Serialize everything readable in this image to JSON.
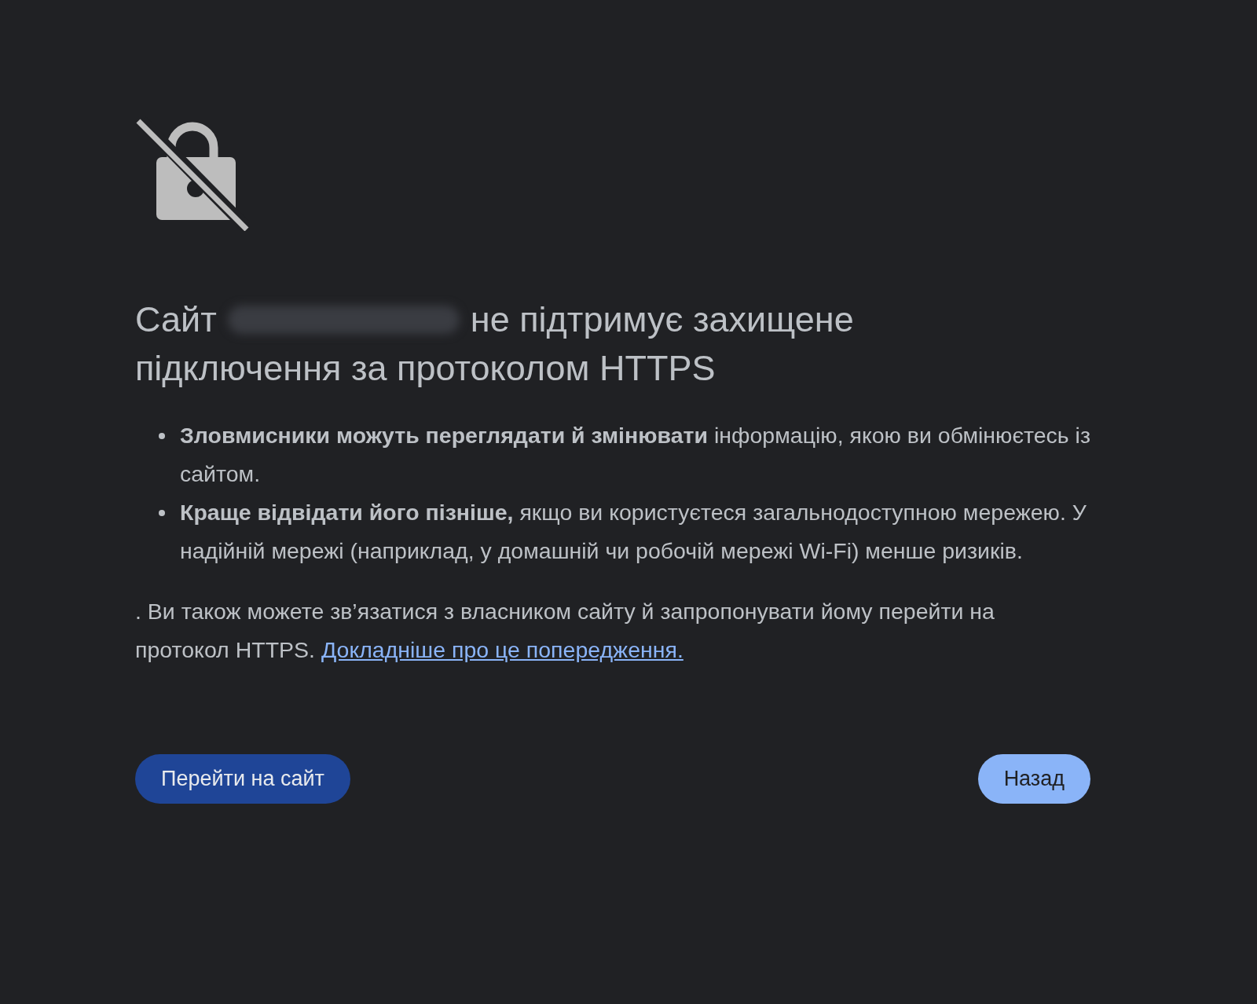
{
  "heading": {
    "before": "Сайт",
    "after": "не підтримує захищене",
    "second_line": "підключення за протоколом HTTPS"
  },
  "bullets": [
    "**Зловмисники можуть переглядати й змінювати** інформацію, якою ви обмінюєтесь із сайтом.",
    "**Краще відвідати його пізніше,** якщо ви користуєтеся загальнодоступною мережею. У надійній мережі (наприклад, у домашній чи робочій мережі Wi-Fi) менше ризиків."
  ],
  "paragraph": {
    "text": ". Ви також можете зв’язатися з власником сайту й запропонувати йому перейти на протокол HTTPS.",
    "link": "Докладніше про це попередження."
  },
  "buttons": [
    {
      "label": "Перейти на сайт",
      "kind": "primary"
    },
    {
      "label": "Назад",
      "kind": "secondary"
    }
  ]
}
